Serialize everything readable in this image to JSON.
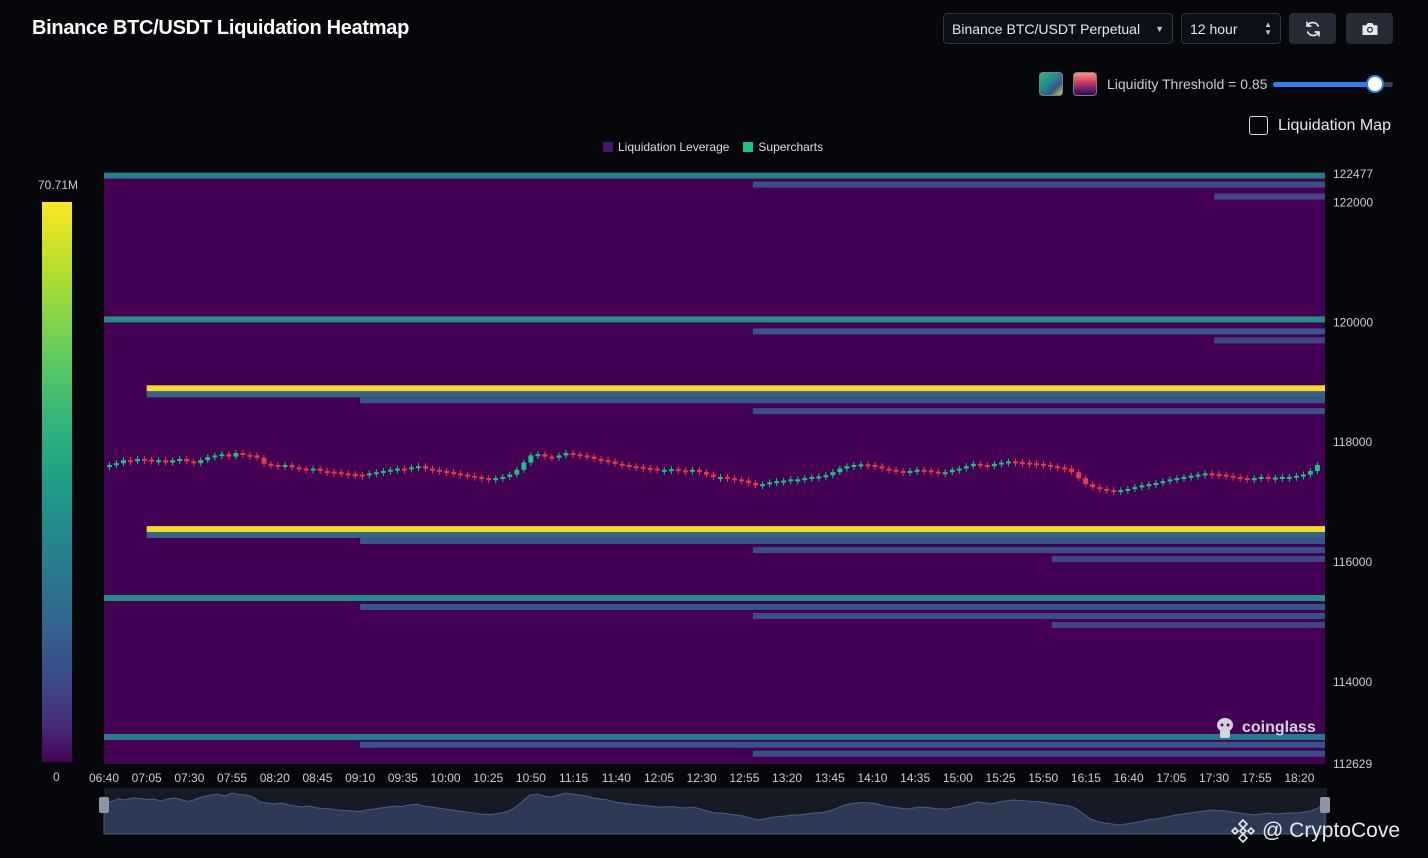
{
  "header": {
    "title": "Binance BTC/USDT Liquidation Heatmap",
    "pair_select": "Binance BTC/USDT Perpetual",
    "time_select": "12 hour",
    "refresh_icon": "refresh-icon",
    "camera_icon": "camera-icon"
  },
  "controls": {
    "threshold_label": "Liquidity Threshold = 0.85",
    "threshold_value": 0.85,
    "liquidation_map_label": "Liquidation Map",
    "liquidation_map_checked": false
  },
  "scale": {
    "max_label": "70.71M",
    "min_label": "0"
  },
  "brand": {
    "logo_text": "coinglass",
    "watermark": "@ CryptoCove"
  },
  "colors": {
    "heatmap_base": "#440154",
    "bright": "#fde725",
    "teal": "#1f9e89",
    "blue": "#31688e",
    "candle_up": "#16c784",
    "candle_down": "#ea3943"
  },
  "chart_data": {
    "type": "heatmap",
    "legend": [
      {
        "name": "Liquidation Leverage",
        "color": "#4a1570"
      },
      {
        "name": "Supercharts",
        "color": "#16c784"
      }
    ],
    "ylim": [
      112629,
      122477
    ],
    "y_ticks": [
      122477,
      122000,
      120000,
      118000,
      116000,
      114000,
      112629
    ],
    "x_ticks": [
      "06:40",
      "07:05",
      "07:30",
      "07:55",
      "08:20",
      "08:45",
      "09:10",
      "09:35",
      "10:00",
      "10:25",
      "10:50",
      "11:15",
      "11:40",
      "12:05",
      "12:30",
      "12:55",
      "13:20",
      "13:45",
      "14:10",
      "14:35",
      "15:00",
      "15:25",
      "15:50",
      "16:15",
      "16:40",
      "17:05",
      "17:30",
      "17:55",
      "18:20"
    ],
    "x_start_minutes": 400,
    "x_end_minutes": 1115,
    "liquidation_bands": [
      {
        "price": 122450,
        "intensity": 0.45,
        "start": "06:40"
      },
      {
        "price": 122300,
        "intensity": 0.2,
        "start": "13:00"
      },
      {
        "price": 122100,
        "intensity": 0.15,
        "start": "17:30"
      },
      {
        "price": 120050,
        "intensity": 0.55,
        "start": "06:40"
      },
      {
        "price": 119850,
        "intensity": 0.25,
        "start": "13:00"
      },
      {
        "price": 119700,
        "intensity": 0.15,
        "start": "17:30"
      },
      {
        "price": 118900,
        "intensity": 1.0,
        "start": "07:05"
      },
      {
        "price": 118800,
        "intensity": 0.35,
        "start": "07:05"
      },
      {
        "price": 118700,
        "intensity": 0.25,
        "start": "09:10"
      },
      {
        "price": 118520,
        "intensity": 0.2,
        "start": "13:00"
      },
      {
        "price": 116550,
        "intensity": 1.0,
        "start": "07:05"
      },
      {
        "price": 116450,
        "intensity": 0.35,
        "start": "07:05"
      },
      {
        "price": 116350,
        "intensity": 0.25,
        "start": "09:10"
      },
      {
        "price": 116200,
        "intensity": 0.2,
        "start": "13:00"
      },
      {
        "price": 116050,
        "intensity": 0.15,
        "start": "15:55"
      },
      {
        "price": 115400,
        "intensity": 0.55,
        "start": "06:40"
      },
      {
        "price": 115250,
        "intensity": 0.25,
        "start": "09:10"
      },
      {
        "price": 115100,
        "intensity": 0.2,
        "start": "13:00"
      },
      {
        "price": 114950,
        "intensity": 0.15,
        "start": "15:55"
      },
      {
        "price": 113080,
        "intensity": 0.45,
        "start": "06:40"
      },
      {
        "price": 112950,
        "intensity": 0.25,
        "start": "09:10"
      },
      {
        "price": 112800,
        "intensity": 0.2,
        "start": "13:00"
      }
    ],
    "price_series": [
      117620,
      117650,
      117700,
      117680,
      117720,
      117710,
      117690,
      117700,
      117660,
      117700,
      117720,
      117680,
      117650,
      117700,
      117750,
      117780,
      117800,
      117760,
      117820,
      117790,
      117780,
      117740,
      117640,
      117620,
      117600,
      117620,
      117580,
      117560,
      117540,
      117560,
      117520,
      117510,
      117500,
      117480,
      117470,
      117460,
      117450,
      117480,
      117500,
      117520,
      117540,
      117560,
      117550,
      117580,
      117600,
      117560,
      117540,
      117520,
      117500,
      117480,
      117460,
      117440,
      117420,
      117400,
      117390,
      117400,
      117420,
      117460,
      117540,
      117660,
      117780,
      117800,
      117760,
      117740,
      117780,
      117820,
      117800,
      117780,
      117760,
      117720,
      117700,
      117680,
      117640,
      117620,
      117600,
      117590,
      117570,
      117560,
      117540,
      117540,
      117550,
      117530,
      117520,
      117540,
      117500,
      117460,
      117420,
      117420,
      117400,
      117380,
      117360,
      117320,
      117280,
      117300,
      117330,
      117350,
      117360,
      117380,
      117380,
      117400,
      117420,
      117430,
      117450,
      117500,
      117560,
      117600,
      117620,
      117630,
      117620,
      117600,
      117560,
      117540,
      117520,
      117500,
      117520,
      117540,
      117530,
      117510,
      117500,
      117500,
      117540,
      117560,
      117600,
      117640,
      117620,
      117600,
      117640,
      117660,
      117680,
      117670,
      117660,
      117650,
      117640,
      117620,
      117600,
      117580,
      117560,
      117500,
      117400,
      117300,
      117250,
      117220,
      117200,
      117180,
      117200,
      117220,
      117250,
      117280,
      117300,
      117320,
      117350,
      117380,
      117400,
      117420,
      117440,
      117460,
      117480,
      117470,
      117460,
      117440,
      117420,
      117400,
      117380,
      117400,
      117420,
      117400,
      117410,
      117420,
      117420,
      117440,
      117460,
      117520,
      117620
    ]
  }
}
